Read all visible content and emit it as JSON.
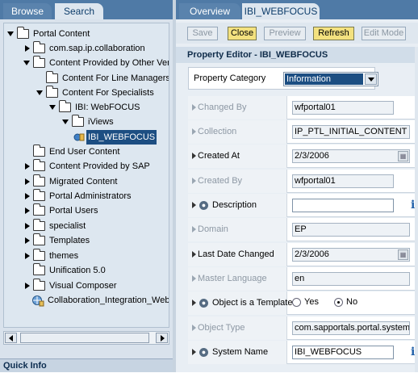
{
  "left_tabs": {
    "browse": "Browse",
    "search": "Search"
  },
  "tree": [
    {
      "label": "Portal Content",
      "state": "expanded"
    },
    {
      "label": "com.sap.ip.collaboration",
      "state": "collapsed"
    },
    {
      "label": "Content Provided by Other Vend",
      "state": "expanded"
    },
    {
      "label": "Content For Line Managers",
      "state": "none"
    },
    {
      "label": "Content For Specialists",
      "state": "expanded"
    },
    {
      "label": "IBI: WebFOCUS",
      "state": "expanded"
    },
    {
      "label": "iViews",
      "state": "expanded"
    },
    {
      "label": "IBI_WEBFOCUS",
      "state": "none"
    },
    {
      "label": "End User Content",
      "state": "none"
    },
    {
      "label": "Content Provided by SAP",
      "state": "collapsed"
    },
    {
      "label": "Migrated Content",
      "state": "collapsed"
    },
    {
      "label": "Portal Administrators",
      "state": "collapsed"
    },
    {
      "label": "Portal Users",
      "state": "collapsed"
    },
    {
      "label": "specialist",
      "state": "collapsed"
    },
    {
      "label": "Templates",
      "state": "collapsed"
    },
    {
      "label": "themes",
      "state": "collapsed"
    },
    {
      "label": "Unification 5.0",
      "state": "none"
    },
    {
      "label": "Visual Composer",
      "state": "collapsed"
    },
    {
      "label": "Collaboration_Integration_WebEx",
      "state": "none"
    }
  ],
  "quick_info": "Quick Info",
  "right_tabs": {
    "overview": "Overview",
    "editor": "IBI_WEBFOCUS"
  },
  "toolbar": {
    "save": "Save",
    "close": "Close",
    "preview": "Preview",
    "refresh": "Refresh",
    "edit_mode": "Edit Mode"
  },
  "editor_title": "Property Editor - IBI_WEBFOCUS",
  "category": {
    "label": "Property Category",
    "value": "Information"
  },
  "properties": [
    {
      "label": "Changed By",
      "value": "wfportal01",
      "mode": "ro"
    },
    {
      "label": "Collection",
      "value": "IP_PTL_INITIAL_CONTENT",
      "mode": "ro"
    },
    {
      "label": "Created At",
      "value": "2/3/2006",
      "mode": "date"
    },
    {
      "label": "Created By",
      "value": "wfportal01",
      "mode": "ro"
    },
    {
      "label": "Description",
      "value": "",
      "mode": "rw"
    },
    {
      "label": "Domain",
      "value": "EP",
      "mode": "ro"
    },
    {
      "label": "Last Date Changed",
      "value": "2/3/2006",
      "mode": "date"
    },
    {
      "label": "Master Language",
      "value": "en",
      "mode": "ro"
    },
    {
      "label": "Object is a Template",
      "value": "",
      "mode": "radio"
    },
    {
      "label": "Object Type",
      "value": "com.sapportals.portal.system",
      "mode": "ro"
    },
    {
      "label": "System Name",
      "value": "IBI_WEBFOCUS",
      "mode": "rw"
    }
  ],
  "radio": {
    "yes": "Yes",
    "no": "No",
    "selected": "No"
  },
  "colors": {
    "accent": "#1c4e82",
    "tab_bar": "#4f7aa6",
    "button_enabled": "#f3e17f"
  }
}
